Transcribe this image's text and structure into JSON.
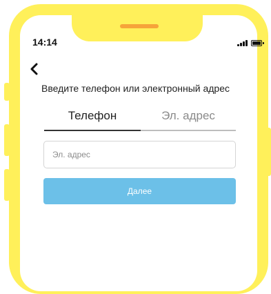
{
  "status_bar": {
    "time": "14:14"
  },
  "login": {
    "prompt": "Введите телефон или электронный адрес",
    "tabs": [
      {
        "label": "Телефон",
        "active": true
      },
      {
        "label": "Эл. адрес",
        "active": false
      }
    ],
    "email_input": {
      "value": "",
      "placeholder": "Эл. адрес"
    },
    "next_button": "Далее"
  },
  "colors": {
    "frame": "#fff05a",
    "speaker": "#f6a43a",
    "button": "#6cc0e8",
    "active_tab_line": "#333333",
    "inactive_tab_line": "#bdbdbd"
  },
  "icons": [
    "back-chevron-icon",
    "signal-icon",
    "battery-icon"
  ]
}
